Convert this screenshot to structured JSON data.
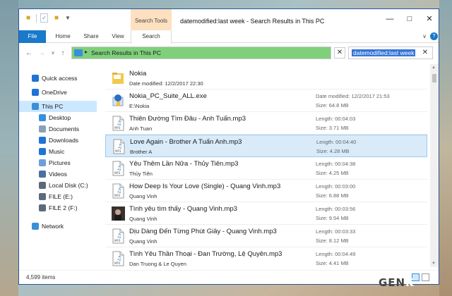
{
  "window": {
    "title": "datemodified:last week - Search Results in This PC",
    "context_tab": "Search Tools"
  },
  "ribbon": {
    "tabs": [
      "File",
      "Home",
      "Share",
      "View",
      "Search"
    ]
  },
  "address": {
    "path": "Search Results in This PC",
    "search_query": "datemodified:last week"
  },
  "sidebar": {
    "items": [
      {
        "label": "Quick access",
        "icon": "star-icon",
        "color": "#1e73d6"
      },
      {
        "label": "OneDrive",
        "icon": "cloud-icon",
        "color": "#1e73d6"
      },
      {
        "label": "This PC",
        "icon": "computer-icon",
        "color": "#3b8fd9"
      },
      {
        "label": "Desktop",
        "icon": "desktop-icon",
        "color": "#3b8fd9"
      },
      {
        "label": "Documents",
        "icon": "documents-icon",
        "color": "#8aa0b8"
      },
      {
        "label": "Downloads",
        "icon": "download-icon",
        "color": "#1e73d6"
      },
      {
        "label": "Music",
        "icon": "music-icon",
        "color": "#1e73d6"
      },
      {
        "label": "Pictures",
        "icon": "pictures-icon",
        "color": "#6aa0d8"
      },
      {
        "label": "Videos",
        "icon": "videos-icon",
        "color": "#4b6fa0"
      },
      {
        "label": "Local Disk (C:)",
        "icon": "drive-icon",
        "color": "#5a6b7c"
      },
      {
        "label": "FILE (E:)",
        "icon": "drive-icon",
        "color": "#5a6b7c"
      },
      {
        "label": "FILE 2 (F:)",
        "icon": "drive-icon",
        "color": "#5a6b7c"
      },
      {
        "label": "Network",
        "icon": "network-icon",
        "color": "#3b8fd9"
      }
    ]
  },
  "results": [
    {
      "name": "Nokia",
      "sub": "Date modified: 12/2/2017 22:30",
      "meta1": "",
      "meta2": "",
      "icon": "folder-icon"
    },
    {
      "name": "Nokia_PC_Suite_ALL.exe",
      "sub": "E:\\Nokia",
      "meta1": "Date modified: 12/2/2017 21:53",
      "meta2": "Size: 64.8 MB",
      "icon": "installer-icon"
    },
    {
      "name": "Thiên Đường Tìm Đâu - Anh Tuấn.mp3",
      "sub": "Anh Tuan",
      "meta1": "Length: 00:04:03",
      "meta2": "Size: 3.71 MB",
      "icon": "mp3-file-icon"
    },
    {
      "name": "Love Again - Brother A Tuấn Anh.mp3",
      "sub": "Brother A",
      "meta1": "Length: 00:04:40",
      "meta2": "Size: 4.28 MB",
      "icon": "mp3-file-icon"
    },
    {
      "name": "Yêu Thêm Lần Nữa - Thủy Tiên.mp3",
      "sub": "Thủy Tiên",
      "meta1": "Length: 00:04:38",
      "meta2": "Size: 4.25 MB",
      "icon": "mp3-file-icon"
    },
    {
      "name": "How Deep Is Your Love (Single) - Quang Vinh.mp3",
      "sub": "Quang Vinh",
      "meta1": "Length: 00:03:00",
      "meta2": "Size: 6.88 MB",
      "icon": "mp3-file-icon"
    },
    {
      "name": "Tình yêu tìm thấy - Quang Vinh.mp3",
      "sub": "Quang Vinh",
      "meta1": "Length: 00:03:56",
      "meta2": "Size: 9.54 MB",
      "icon": "album-art-icon"
    },
    {
      "name": "Dịu Dàng Đến Từng Phút Giây - Quang Vinh.mp3",
      "sub": "Quang Vinh",
      "meta1": "Length: 00:03:33",
      "meta2": "Size: 8.12 MB",
      "icon": "mp3-file-icon"
    },
    {
      "name": "Tình Yêu Thần Thoại - Đan Trường, Lệ Quyên.mp3",
      "sub": "Dan Truong & Le Quyen",
      "meta1": "Length: 00:04:49",
      "meta2": "Size: 4.41 MB",
      "icon": "mp3-file-icon"
    }
  ],
  "selected_index": 3,
  "status": {
    "count": "4,599 items"
  },
  "watermark": "GENK",
  "colors": {
    "accent": "#1979ca",
    "address_bar": "#7fd07b",
    "selection": "#d9ebf9",
    "context_tab": "#fde0c0"
  }
}
